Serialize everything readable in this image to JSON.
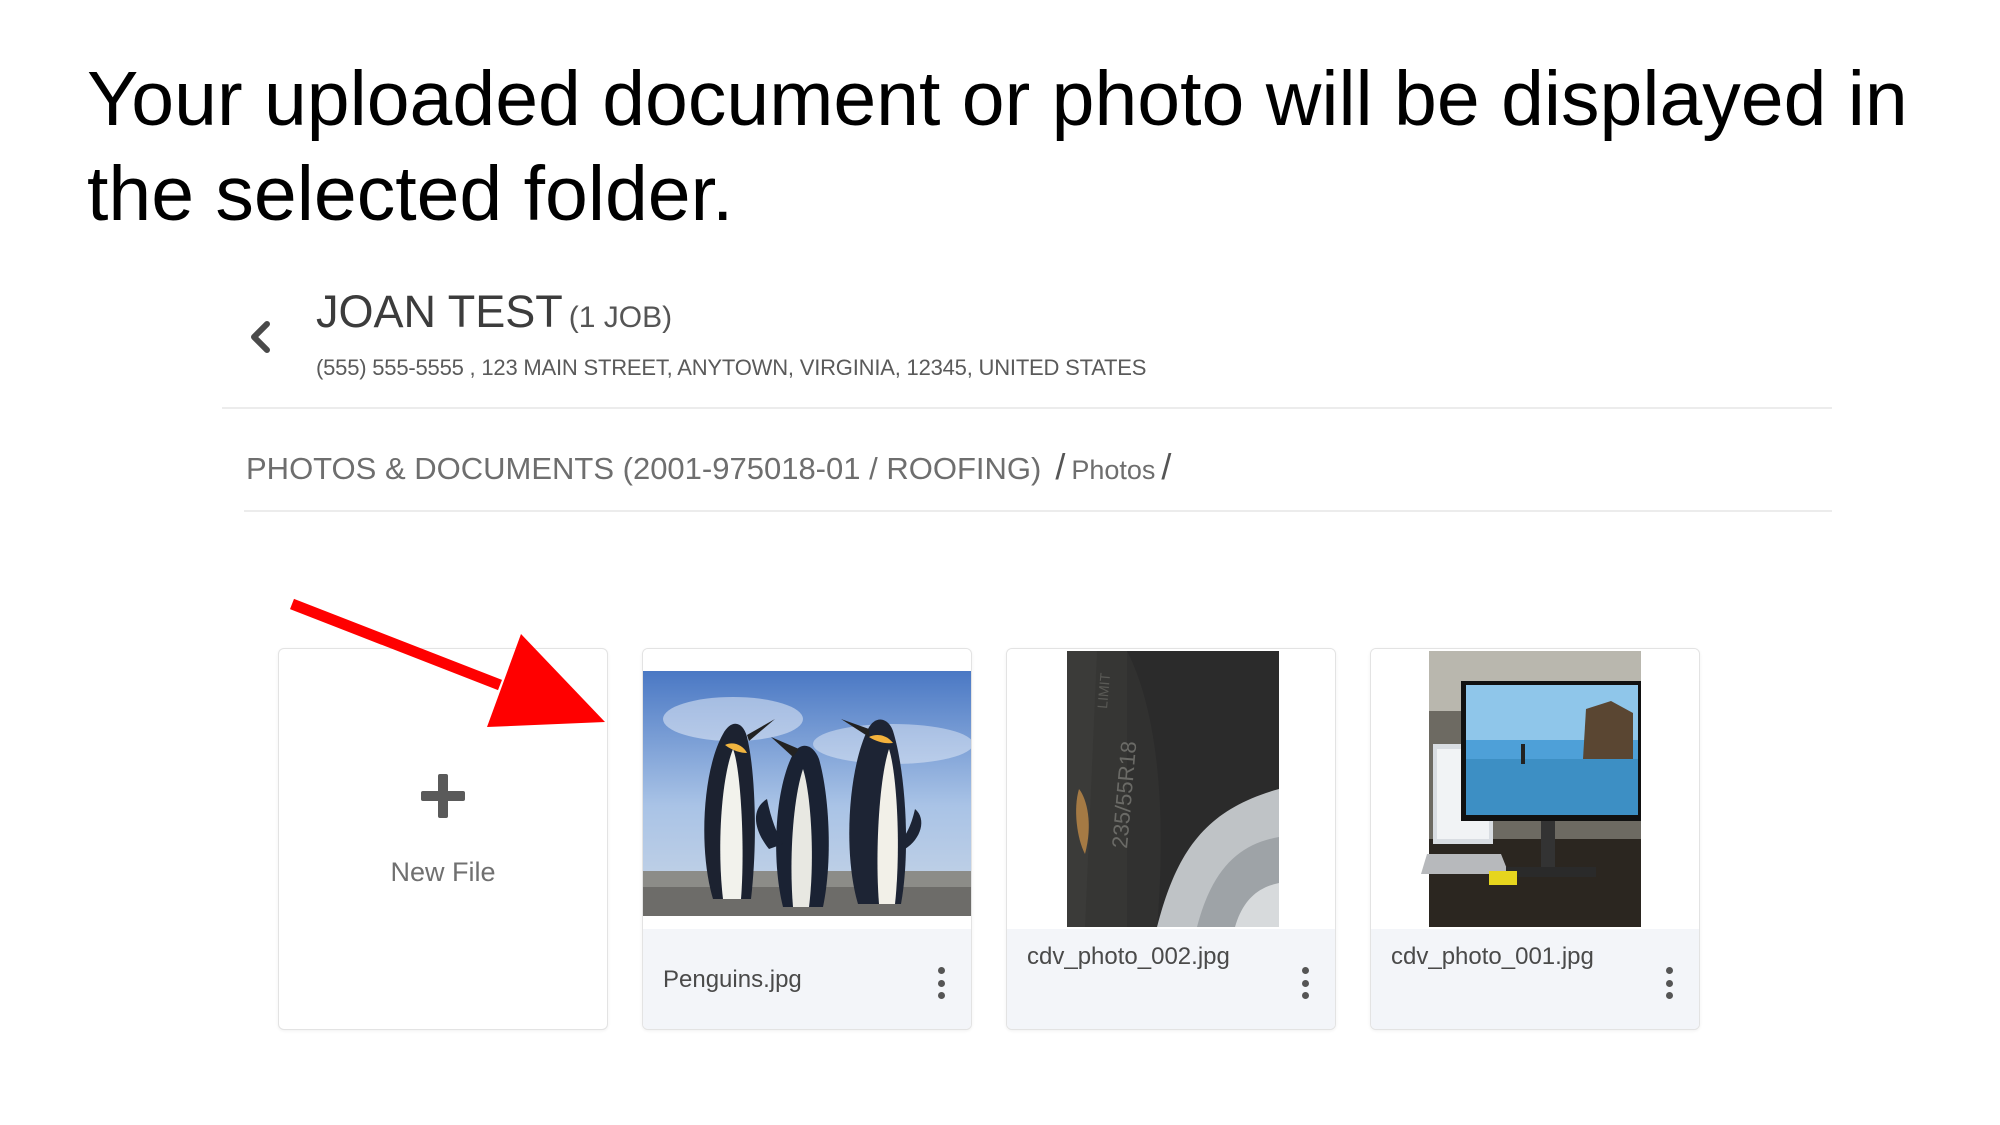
{
  "slide": {
    "title": "Your uploaded document or photo will be displayed in the selected folder."
  },
  "customer": {
    "name": "JOAN TEST",
    "job_count": "(1 JOB)",
    "address": "(555) 555-5555 , 123 MAIN STREET, ANYTOWN, VIRGINIA, 12345, UNITED STATES"
  },
  "breadcrumb": {
    "root": "PHOTOS & DOCUMENTS (2001-975018-01 / ROOFING)",
    "separator": "/",
    "folder": "Photos"
  },
  "new_file": {
    "label": "New File",
    "icon": "plus-icon"
  },
  "files": [
    {
      "name": "Penguins.jpg",
      "thumbnail": "penguins"
    },
    {
      "name": "cdv_photo_002.jpg",
      "thumbnail": "tire"
    },
    {
      "name": "cdv_photo_001.jpg",
      "thumbnail": "monitor"
    }
  ],
  "colors": {
    "annotation_arrow": "#ff0000",
    "card_footer": "#f3f5f9"
  }
}
